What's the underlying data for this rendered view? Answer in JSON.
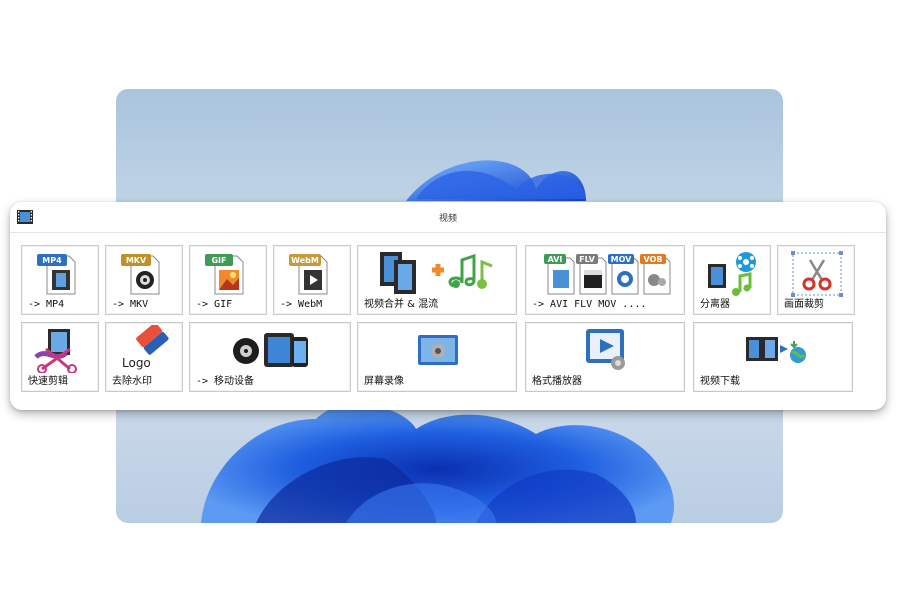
{
  "panel": {
    "title": "视频",
    "app_icon": "film-strip-icon"
  },
  "tiles": [
    {
      "label": "-> MP4",
      "badge": "MP4",
      "badge_color": "#2f6fbf",
      "icon": "mp4-file-icon"
    },
    {
      "label": "-> MKV",
      "badge": "MKV",
      "badge_color": "#c0902a",
      "icon": "mkv-file-icon"
    },
    {
      "label": "-> GIF",
      "badge": "GIF",
      "badge_color": "#3f9a55",
      "icon": "gif-file-icon"
    },
    {
      "label": "-> WebM",
      "badge": "WebM",
      "badge_color": "#c89a3a",
      "icon": "webm-file-icon"
    },
    {
      "label": "视频合并 & 混流",
      "icon": "merge-mux-icon"
    },
    {
      "label": "-> AVI FLV MOV ....",
      "badges": [
        "AVI",
        "FLV",
        "MOV",
        "VOB"
      ],
      "badge_colors": [
        "#3f9a55",
        "#7a7a7a",
        "#2f6fbf",
        "#e07a1f"
      ],
      "icon": "multi-format-icon"
    },
    {
      "label": "分离器",
      "icon": "splitter-icon"
    },
    {
      "label": "画面裁剪",
      "icon": "crop-scissors-icon"
    },
    {
      "label": "快速剪辑",
      "icon": "quick-clip-icon"
    },
    {
      "label": "去除水印",
      "logo_text": "Logo",
      "icon": "remove-watermark-icon"
    },
    {
      "label": "-> 移动设备",
      "icon": "mobile-device-icon"
    },
    {
      "label": "屏幕录像",
      "icon": "screen-record-icon"
    },
    {
      "label": "格式播放器",
      "icon": "format-player-icon"
    },
    {
      "label": "视频下载",
      "icon": "video-download-icon"
    }
  ],
  "colors": {
    "accent_blue": "#2f6fbf",
    "wallpaper_blue": "#1f5fe0"
  }
}
